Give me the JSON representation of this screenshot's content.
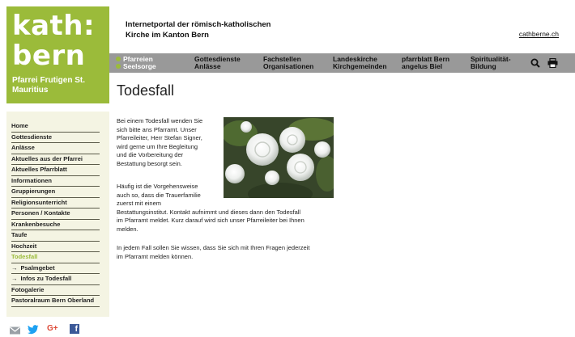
{
  "logo": {
    "text_line1": "kath:",
    "text_line2": "bern",
    "subtitle": "Pfarrei Frutigen St. Mauritius"
  },
  "header": {
    "portal_title_line1": "Internetportal der römisch-katholischen",
    "portal_title_line2": "Kirche im Kanton Bern",
    "link": "cathberne.ch"
  },
  "topnav": {
    "items": [
      {
        "line1": "Pfarreien",
        "line2": "Seelsorge",
        "active": true
      },
      {
        "line1": "Gottesdienste",
        "line2": "Anlässe"
      },
      {
        "line1": "Fachstellen",
        "line2": "Organisationen"
      },
      {
        "line1": "Landeskirche",
        "line2": "Kirchgemeinden"
      },
      {
        "line1": "pfarrblatt Bern",
        "line2": "angelus Biel"
      },
      {
        "line1": "Spiritualität-",
        "line2": "Bildung"
      }
    ],
    "icons": [
      "search-icon",
      "print-icon"
    ]
  },
  "page_title": "Todesfall",
  "sidebar": {
    "items": [
      {
        "label": "Home"
      },
      {
        "label": "Gottesdienste"
      },
      {
        "label": "Anlässe"
      },
      {
        "label": "Aktuelles aus der Pfarrei"
      },
      {
        "label": "Aktuelles Pfarrblatt"
      },
      {
        "label": "Informationen"
      },
      {
        "label": "Gruppierungen"
      },
      {
        "label": "Religionsunterricht"
      },
      {
        "label": "Personen / Kontakte"
      },
      {
        "label": "Krankenbesuche"
      },
      {
        "label": "Taufe"
      },
      {
        "label": "Hochzeit"
      },
      {
        "label": "Todesfall",
        "active": true
      },
      {
        "label": "Psalmgebet",
        "arrow": "→"
      },
      {
        "label": "Infos zu Todesfall",
        "arrow": "→"
      },
      {
        "label": "Fotogalerie"
      },
      {
        "label": "Pastoralraum Bern Oberland"
      }
    ]
  },
  "content": {
    "p1_lines": [
      "Bei einem Todesfall wenden Sie",
      "sich bitte ans Pfarramt. Unser",
      "Pfarreileiter, Herr Stefan Signer,",
      "wird gerne um Ihre Begleitung",
      "und die Vorbereitung der",
      "Bestattung besorgt sein."
    ],
    "p2_lines": [
      "Häufig ist die Vorgehensweise",
      "auch so, dass die Trauerfamilie",
      "zuerst mit einem",
      "Bestattungsinstitut. Kontakt aufnimmt und dieses dann den Todesfall",
      "im Pfarramt meldet. Kurz darauf wird sich unser Pfarreileiter bei Ihnen",
      "melden."
    ],
    "p3_lines": [
      "In jedem Fall sollen Sie wissen, dass Sie sich mit Ihren Fragen jederzeit",
      "im Pfarramt melden können."
    ]
  },
  "social": {
    "icons": [
      "email-icon",
      "twitter-icon",
      "google-plus-icon",
      "facebook-icon"
    ],
    "google_plus_label": "G+",
    "facebook_label": "f"
  },
  "colors": {
    "brand_green": "#9bbb3a",
    "nav_gray": "#999999",
    "sidebar_bg": "#f4f4e3"
  }
}
